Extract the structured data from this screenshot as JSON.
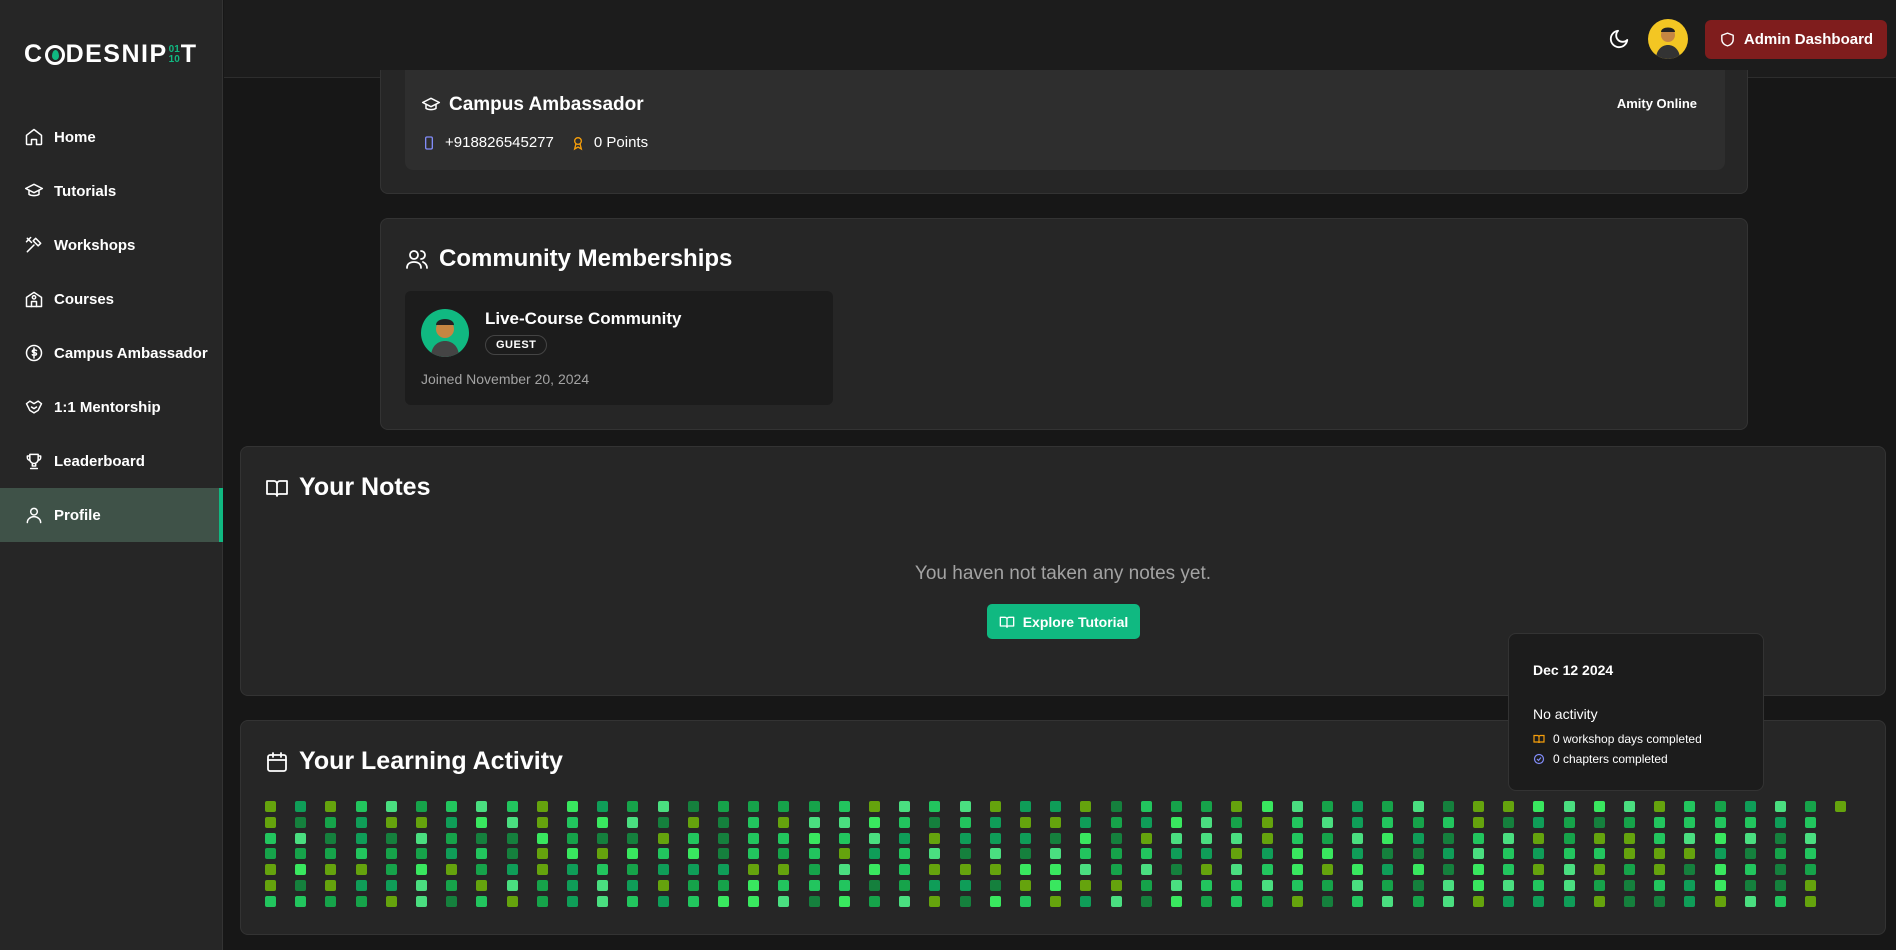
{
  "sidebar": {
    "logo": {
      "prefix": "C",
      "suffix": "DESNIP",
      "bits_top": "01",
      "bits_bottom": "10",
      "end": "T"
    },
    "items": [
      {
        "label": "Home",
        "icon": "home-icon"
      },
      {
        "label": "Tutorials",
        "icon": "graduation-cap-icon"
      },
      {
        "label": "Workshops",
        "icon": "tools-icon"
      },
      {
        "label": "Courses",
        "icon": "school-icon"
      },
      {
        "label": "Campus Ambassador",
        "icon": "dollar-circle-icon"
      },
      {
        "label": "1:1 Mentorship",
        "icon": "handshake-icon"
      },
      {
        "label": "Leaderboard",
        "icon": "trophy-icon"
      },
      {
        "label": "Profile",
        "icon": "user-icon",
        "active": true
      }
    ]
  },
  "header": {
    "admin_label": "Admin Dashboard"
  },
  "ambassador": {
    "title": "Campus Ambassador",
    "org": "Amity Online",
    "phone": "+918826545277",
    "points": "0 Points"
  },
  "community": {
    "title": "Community Memberships",
    "name": "Live-Course Community",
    "role": "GUEST",
    "joined": "Joined November 20, 2024"
  },
  "notes": {
    "title": "Your Notes",
    "empty": "You haven not taken any notes yet.",
    "button": "Explore Tutorial"
  },
  "activity": {
    "title": "Your Learning Activity"
  },
  "tooltip": {
    "date": "Dec 12 2024",
    "status": "No activity",
    "workshops": "0 workshop days completed",
    "chapters": "0 chapters completed"
  },
  "colors": {
    "accent": "#10b981",
    "admin": "#7f1d1d",
    "cells": [
      "#22c55e",
      "#16a34a",
      "#4ade80",
      "#65a30d",
      "#15803d",
      "#39e75f",
      "#0f9d58"
    ]
  }
}
